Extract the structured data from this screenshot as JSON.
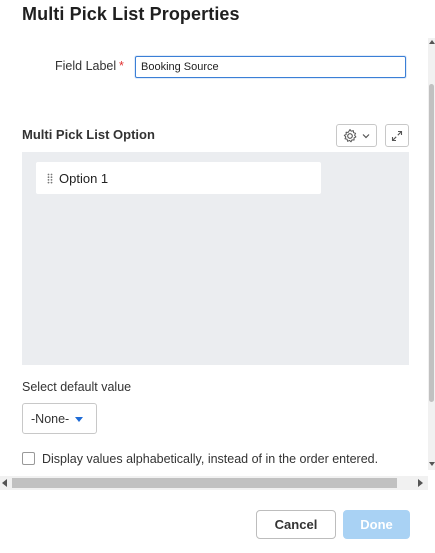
{
  "dialog": {
    "title": "Multi Pick List Properties"
  },
  "field_label": {
    "label": "Field Label",
    "required_marker": "*",
    "value": "Booking Source"
  },
  "options_section": {
    "title": "Multi Pick List Option",
    "settings_icon": "gear-icon",
    "dropdown_icon": "chevron-down-icon",
    "expand_icon": "expand-icon",
    "options": [
      {
        "label": "Option 1"
      }
    ]
  },
  "default_value": {
    "label": "Select default value",
    "selected": "-None-"
  },
  "sort_option": {
    "checked": false,
    "label": "Display values alphabetically, instead of in the order entered."
  },
  "footer": {
    "cancel_label": "Cancel",
    "done_label": "Done"
  },
  "colors": {
    "primary_disabled": "#a9d2f4",
    "input_focus_border": "#3b7fd6",
    "required": "#e03030",
    "options_background": "#ebedf0"
  }
}
